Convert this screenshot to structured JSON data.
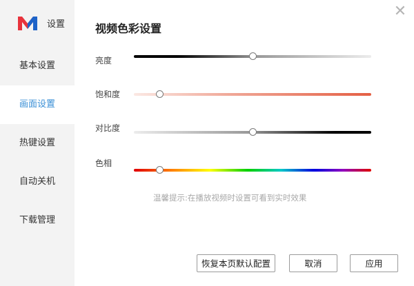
{
  "app": {
    "title": "设置"
  },
  "sidebar": {
    "items": [
      {
        "label": "基本设置",
        "active": false
      },
      {
        "label": "画面设置",
        "active": true
      },
      {
        "label": "热键设置",
        "active": false
      },
      {
        "label": "自动关机",
        "active": false
      },
      {
        "label": "下载管理",
        "active": false
      }
    ]
  },
  "main": {
    "title": "视频色彩设置",
    "close_icon": "close-icon",
    "sliders": {
      "brightness": {
        "label": "亮度",
        "value": 0.5
      },
      "saturation": {
        "label": "饱和度",
        "value": 0.11
      },
      "contrast": {
        "label": "对比度",
        "value": 0.5
      },
      "hue": {
        "label": "色相",
        "value": 0.11
      }
    },
    "hint": "温馨提示:在播放视频时设置可看到实时效果"
  },
  "buttons": {
    "reset": "恢复本页默认配置",
    "cancel": "取消",
    "apply": "应用"
  },
  "colors": {
    "accent": "#3a8fd6",
    "logo_red": "#e8333c",
    "logo_blue": "#1e63c8",
    "saturation_end": "#e45f44"
  }
}
